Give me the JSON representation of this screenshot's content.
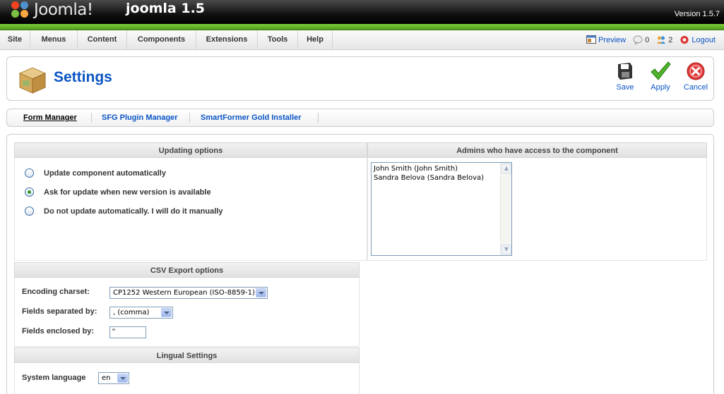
{
  "header": {
    "logo_text": "Joomla!",
    "site_name": "joomla 1.5",
    "version": "Version 1.5.7"
  },
  "menu": [
    "Site",
    "Menus",
    "Content",
    "Components",
    "Extensions",
    "Tools",
    "Help"
  ],
  "status": {
    "preview": "Preview",
    "messages_count": "0",
    "users_count": "2",
    "logout": "Logout"
  },
  "page": {
    "title": "Settings",
    "toolbar": {
      "save": "Save",
      "apply": "Apply",
      "cancel": "Cancel"
    }
  },
  "submenu": [
    "Form Manager",
    "SFG Plugin Manager",
    "SmartFormer Gold Installer"
  ],
  "updating": {
    "heading": "Updating options",
    "options": [
      "Update component automatically",
      "Ask for update when new version is available",
      "Do not update automatically. I will do it manually"
    ],
    "selected_index": 1
  },
  "admins": {
    "heading": "Admins who have access to the component",
    "items": [
      "John Smith (John Smith)",
      "Sandra Belova (Sandra Belova)"
    ]
  },
  "csv": {
    "heading": "CSV Export options",
    "encoding_label": "Encoding charset:",
    "encoding_value": "CP1252 Western European (ISO-8859-1)",
    "separator_label": "Fields separated by:",
    "separator_value": ", (comma)",
    "enclosed_label": "Fields enclosed by:",
    "enclosed_value": "\""
  },
  "lingual": {
    "heading": "Lingual Settings",
    "language_label": "System language",
    "language_value": "en"
  },
  "colors": {
    "link_blue": "#0b55c4",
    "header_green": "#6cc12d",
    "header_black": "#111111"
  }
}
